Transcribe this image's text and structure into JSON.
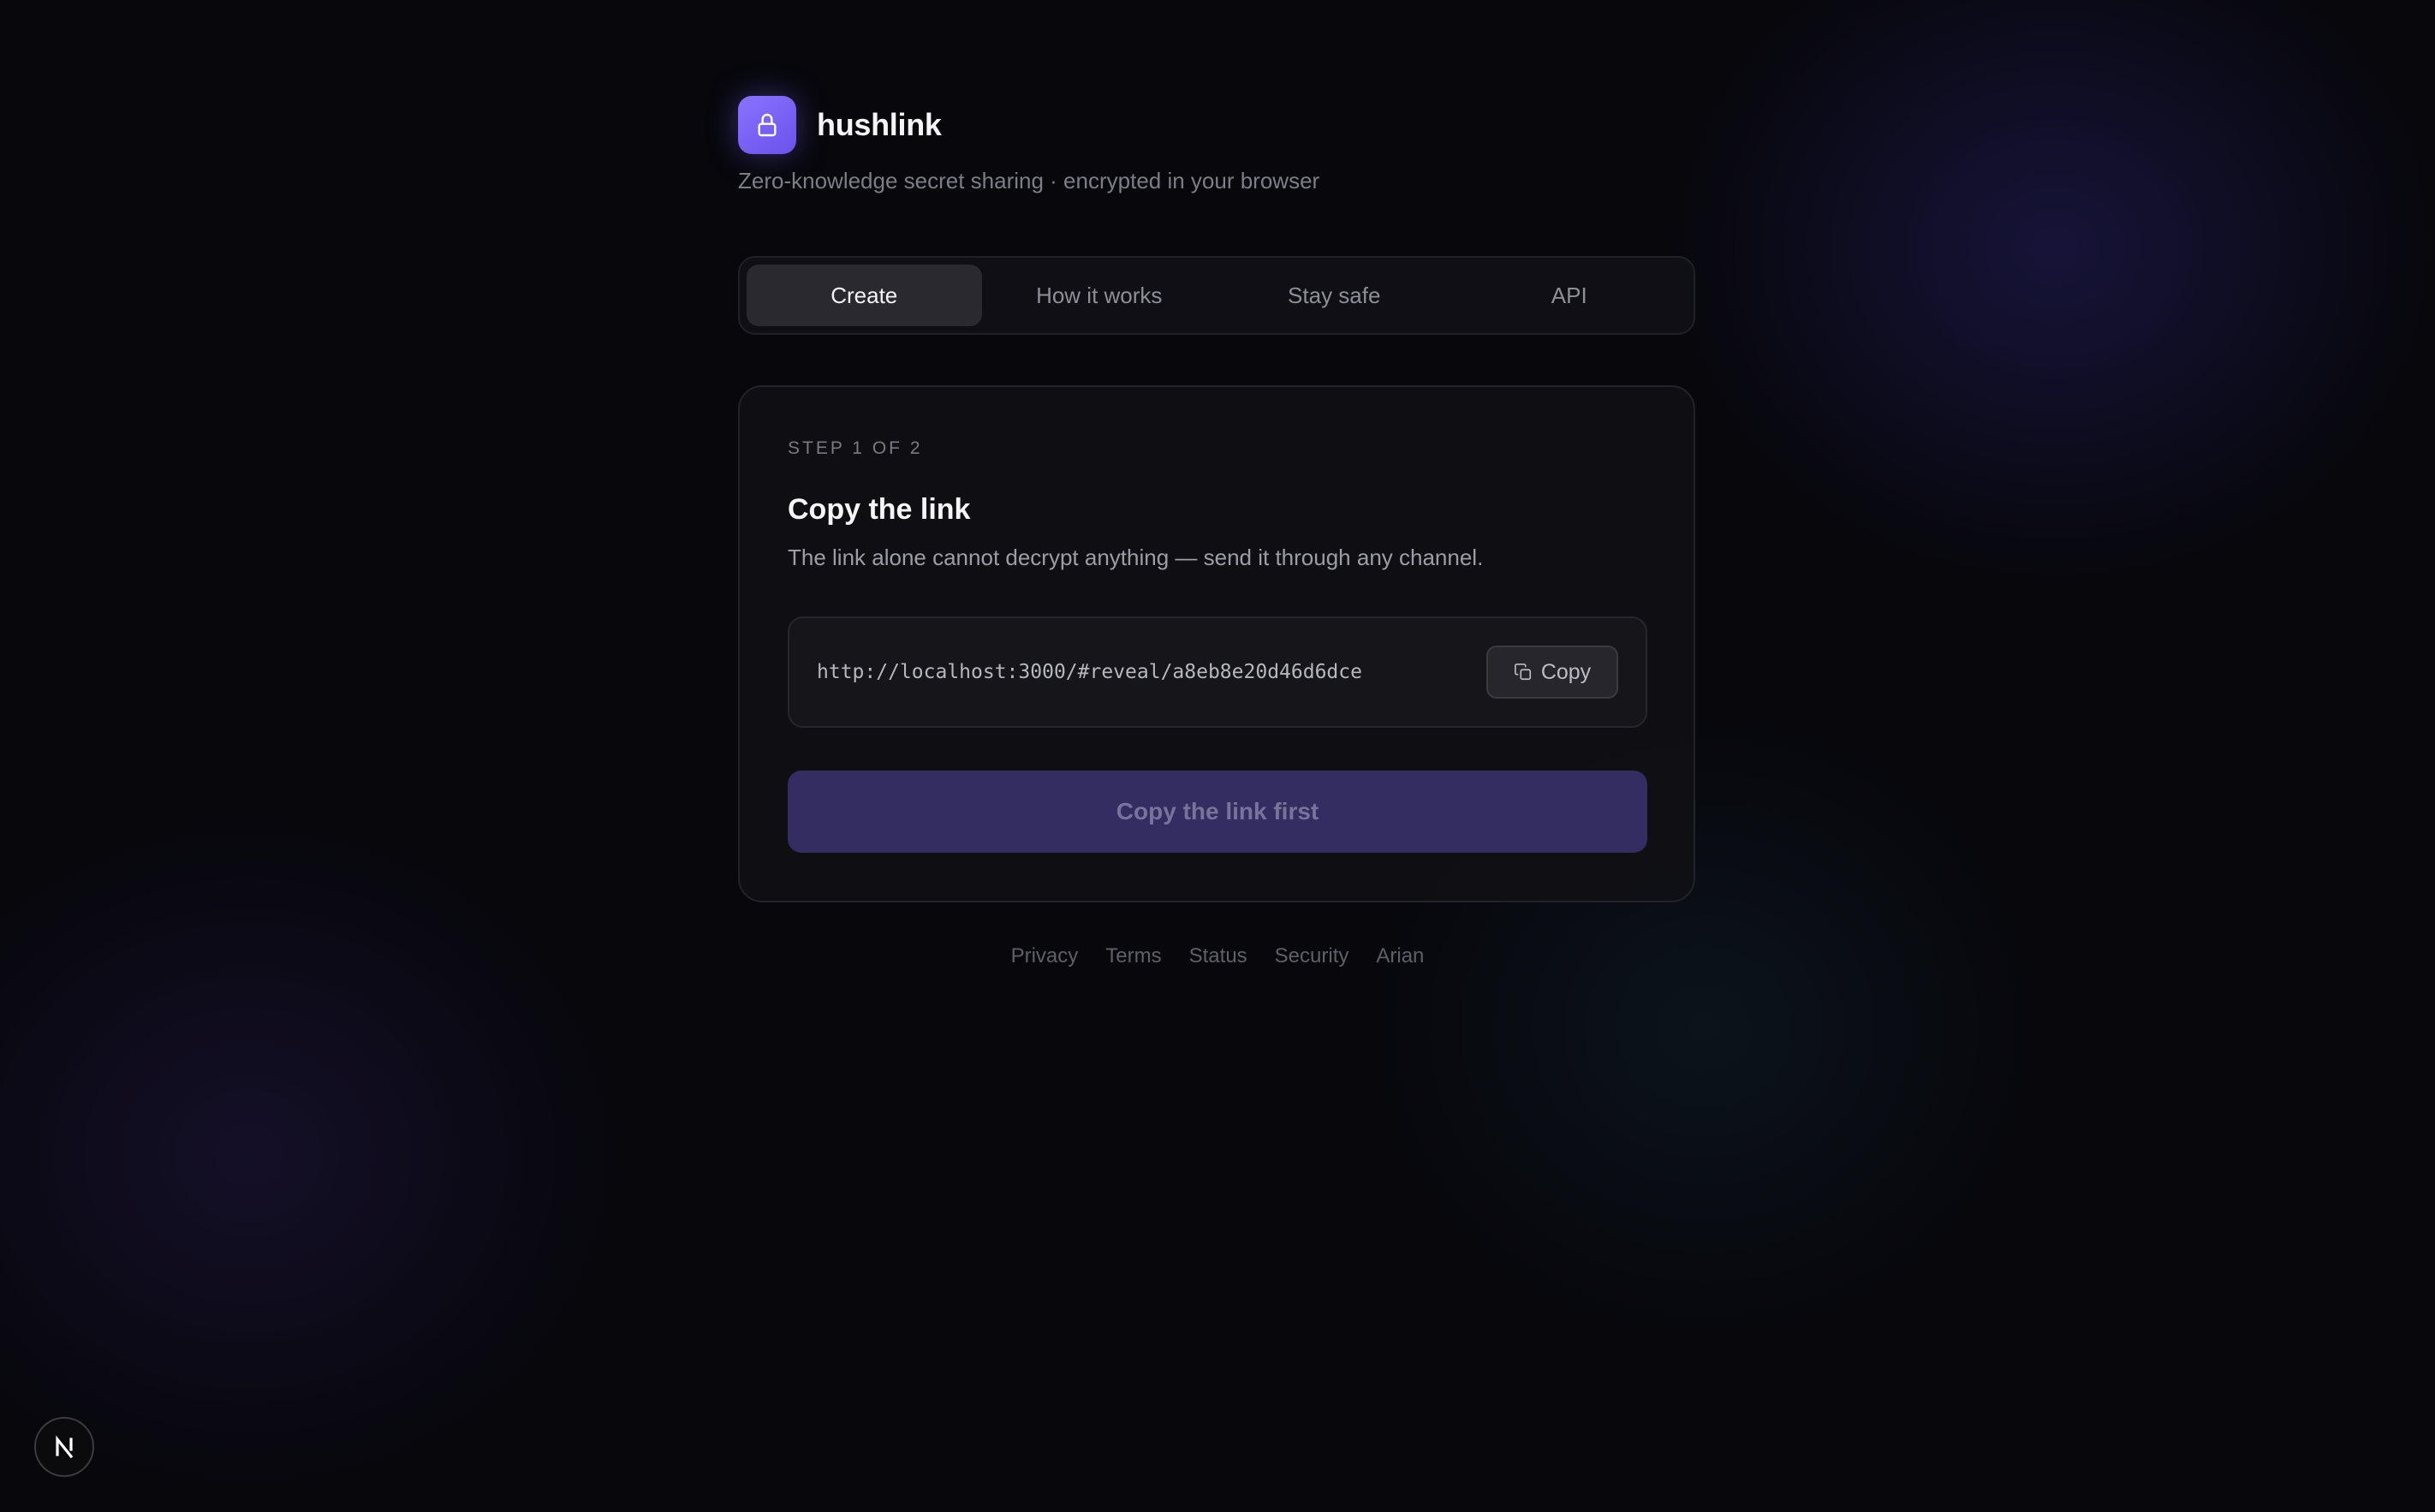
{
  "brand": {
    "name": "hushlink",
    "logo_icon": "lock-icon",
    "tagline": "Zero-knowledge secret sharing · encrypted in your browser"
  },
  "tabs": [
    {
      "label": "Create",
      "active": true
    },
    {
      "label": "How it works",
      "active": false
    },
    {
      "label": "Stay safe",
      "active": false
    },
    {
      "label": "API",
      "active": false
    }
  ],
  "card": {
    "step_label": "STEP 1 OF 2",
    "title": "Copy the link",
    "description": "The link alone cannot decrypt anything — send it through any channel.",
    "link": "http://localhost:3000/#reveal/a8eb8e20d46d6dce",
    "copy_button": {
      "label": "Copy",
      "icon": "copy-icon"
    },
    "primary_button": {
      "label": "Copy the link first",
      "disabled": true
    }
  },
  "footer": {
    "links": [
      "Privacy",
      "Terms",
      "Status",
      "Security",
      "Arian"
    ]
  },
  "corner_badge": {
    "label": "N"
  },
  "colors": {
    "background": "#07070c",
    "accent": "#7c64ff",
    "primary_button_bg": "#342d62",
    "card_bg": "#101015"
  }
}
